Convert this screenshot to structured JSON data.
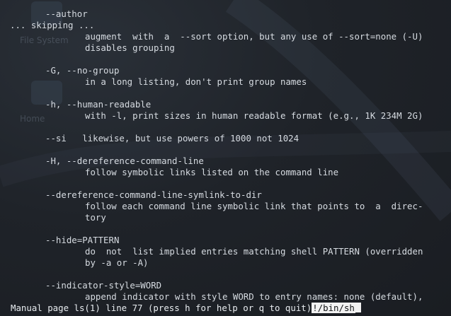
{
  "desktop": {
    "icons": [
      "File System",
      "Home"
    ]
  },
  "man_page": {
    "lines": [
      "--author",
      "... skipping ...",
      "augment  with  a  --sort option, but any use of --sort=none (-U)",
      "disables grouping",
      "-G, --no-group",
      "in a long listing, don't print group names",
      "-h, --human-readable",
      "with -l, print sizes in human readable format (e.g., 1K 234M 2G)",
      "--si   likewise, but use powers of 1000 not 1024",
      "-H, --dereference-command-line",
      "follow symbolic links listed on the command line",
      "--dereference-command-line-symlink-to-dir",
      "follow each command line symbolic link that points to  a  direc-",
      "tory",
      "--hide=PATTERN",
      "do  not  list implied entries matching shell PATTERN (overridden",
      "by -a or -A)",
      "--indicator-style=WORD",
      "append indicator with style WORD to entry names: none (default),"
    ]
  },
  "status_bar": {
    "text": "Manual page ls(1) line 77 (press h for help or q to quit)",
    "command": "!/bin/sh"
  }
}
